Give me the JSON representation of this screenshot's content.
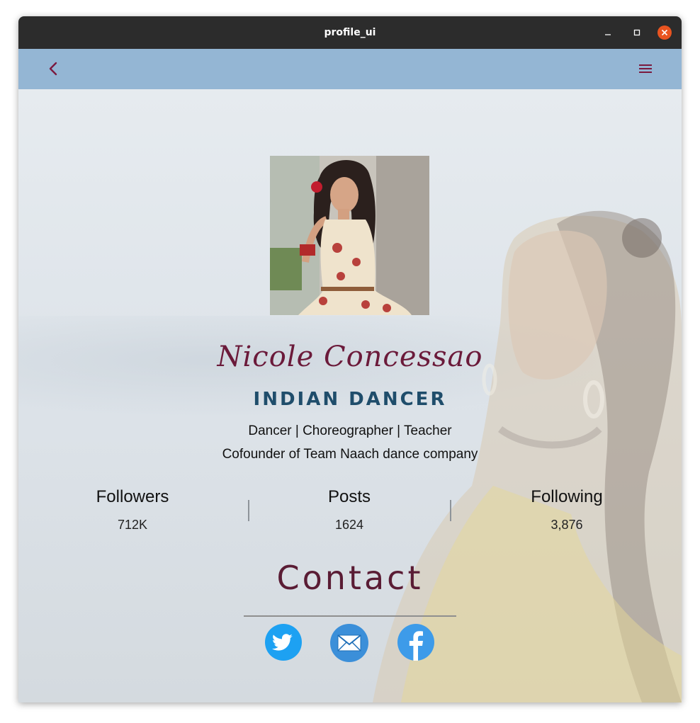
{
  "window": {
    "title": "profile_ui"
  },
  "appbar": {
    "back_icon": "arrow-back-icon",
    "menu_icon": "hamburger-menu-icon",
    "icon_color": "#7b1a3f",
    "background": "#94b6d4"
  },
  "profile": {
    "name": "Nicole Concessao",
    "role": "INDIAN DANCER",
    "bio_line1": "Dancer | Choreographer | Teacher",
    "bio_line2": "Cofounder of Team Naach dance company"
  },
  "stats": [
    {
      "label": "Followers",
      "value": "712K"
    },
    {
      "label": "Posts",
      "value": "1624"
    },
    {
      "label": "Following",
      "value": "3,876"
    }
  ],
  "contact": {
    "heading": "Contact",
    "links": [
      {
        "icon": "twitter-icon",
        "color": "#1da1f2"
      },
      {
        "icon": "email-icon",
        "color": "#3b8fd9"
      },
      {
        "icon": "facebook-icon",
        "color": "#3d9be9"
      }
    ]
  },
  "colors": {
    "name": "#6b1a3a",
    "role": "#1f4d6b",
    "contact": "#5a1c34",
    "close_button": "#e95420"
  }
}
